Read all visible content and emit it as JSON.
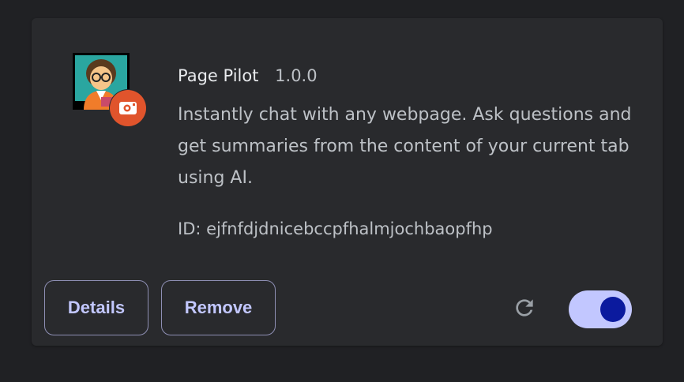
{
  "extension": {
    "name": "Page Pilot",
    "version": "1.0.0",
    "description": "Instantly chat with any webpage. Ask questions and get summaries from the content of your current tab using AI.",
    "id_text": "ID: ejfnfdjdnicebccpfhalmjochbaopfhp",
    "icon": "person-with-glasses-avatar-icon",
    "badge_icon": "unpacked-extension-icon",
    "enabled": true
  },
  "buttons": {
    "details_label": "Details",
    "remove_label": "Remove"
  },
  "colors": {
    "background": "#202124",
    "card": "#292a2d",
    "badge": "#e0542c",
    "toggle_track": "#c2c7ff",
    "toggle_knob": "#0b1a9e",
    "button_text": "#c2c7ff"
  }
}
